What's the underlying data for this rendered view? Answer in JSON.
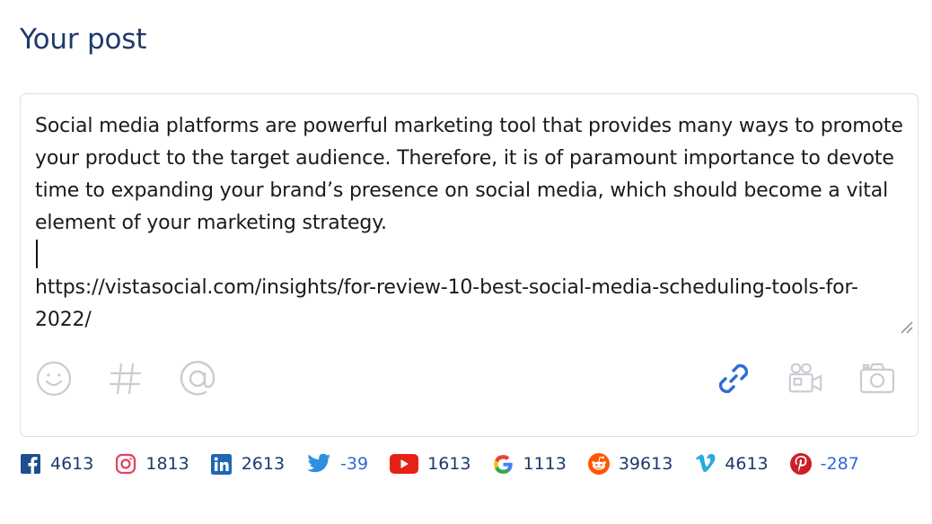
{
  "header": {
    "title": "Your post"
  },
  "post": {
    "text": "Social media platforms are powerful marketing tool that provides many ways to promote your product to the target audience. Therefore, it is of paramount importance to devote time to expanding your brand’s presence on social media, which should become a vital element of your marketing strategy.\n\nhttps://vistasocial.com/insights/for-review-10-best-social-media-scheduling-tools-for-2022/"
  },
  "toolbar": {
    "left": [
      "emoji-icon",
      "hashtag-icon",
      "mention-icon"
    ],
    "right": [
      "link-icon",
      "video-icon",
      "camera-icon"
    ],
    "accent": "#2f6bd8",
    "muted": "#c9ccd1"
  },
  "counts": [
    {
      "network": "facebook",
      "icon": "facebook-icon",
      "value": "4613",
      "color": "#1d4f8f"
    },
    {
      "network": "instagram",
      "icon": "instagram-icon",
      "value": "1813",
      "color": "#e4405f"
    },
    {
      "network": "linkedin",
      "icon": "linkedin-icon",
      "value": "2613",
      "color": "#1e67b3"
    },
    {
      "network": "twitter",
      "icon": "twitter-icon",
      "value": "-39",
      "color": "#2f8ee0"
    },
    {
      "network": "youtube",
      "icon": "youtube-icon",
      "value": "1613",
      "color": "#e62117"
    },
    {
      "network": "google",
      "icon": "google-icon",
      "value": "1113",
      "color": "#4285f4"
    },
    {
      "network": "reddit",
      "icon": "reddit-icon",
      "value": "39613",
      "color": "#ff5700"
    },
    {
      "network": "vimeo",
      "icon": "vimeo-icon",
      "value": "4613",
      "color": "#2aa9e0"
    },
    {
      "network": "pinterest",
      "icon": "pinterest-icon",
      "value": "-287",
      "color": "#cb2027"
    }
  ]
}
